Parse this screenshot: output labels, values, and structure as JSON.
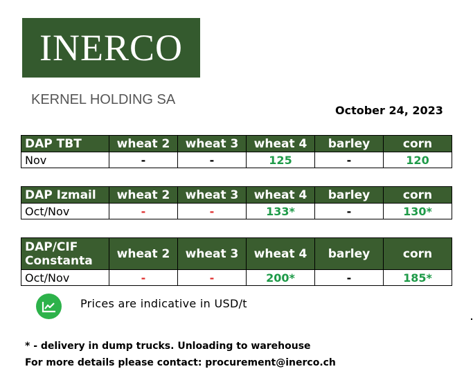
{
  "logo": {
    "text": "INERCO"
  },
  "subtitle": "KERNEL HOLDING SA",
  "date": "October 24, 2023",
  "columns": [
    "wheat 2",
    "wheat 3",
    "wheat 4",
    "barley",
    "corn"
  ],
  "tables": [
    {
      "location": "DAP TBT",
      "period": "Nov",
      "values": [
        "-",
        "-",
        "125",
        "-",
        "120"
      ]
    },
    {
      "location": "DAP Izmail",
      "period": "Oct/Nov",
      "values": [
        "-",
        "-",
        "133*",
        "-",
        "130*"
      ]
    },
    {
      "location_line1": "DAP/CIF",
      "location_line2": "Constanta",
      "period": "Oct/Nov",
      "values": [
        "-",
        "-",
        "200*",
        "-",
        "185*"
      ]
    }
  ],
  "note": "Prices are indicative in USD/t",
  "footnote1": "* - delivery in dump trucks. Unloading to warehouse",
  "footnote2": "For more details please contact: procurement@inerco.ch",
  "colors": {
    "header_green": "#3a5d2f",
    "value_green": "#1e9a48",
    "dash_red": "#e03030",
    "logo_green": "#345a2e"
  },
  "icons": {
    "note_icon": "line-chart-icon"
  }
}
